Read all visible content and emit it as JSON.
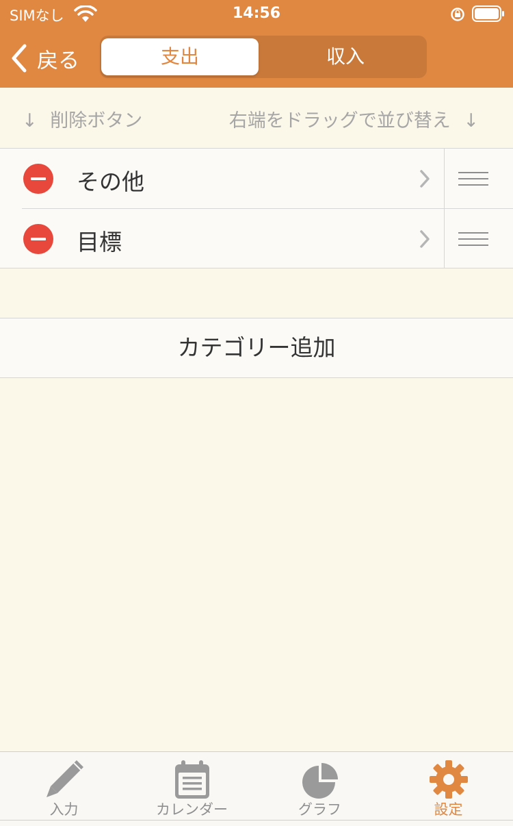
{
  "status_bar": {
    "carrier": "SIMなし",
    "time": "14:56"
  },
  "nav": {
    "back_label": "戻る",
    "segments": [
      {
        "label": "支出",
        "selected": true
      },
      {
        "label": "収入",
        "selected": false
      }
    ]
  },
  "hints": {
    "left_arrow": "↓",
    "left": "削除ボタン",
    "right": "右端をドラッグで並び替え",
    "right_arrow": "↓"
  },
  "categories": [
    {
      "label": "その他"
    },
    {
      "label": "目標"
    }
  ],
  "add_category_label": "カテゴリー追加",
  "tabs": [
    {
      "label": "入力",
      "icon": "pencil-icon",
      "active": false
    },
    {
      "label": "カレンダー",
      "icon": "calendar-icon",
      "active": false
    },
    {
      "label": "グラフ",
      "icon": "pie-chart-icon",
      "active": false
    },
    {
      "label": "設定",
      "icon": "gear-icon",
      "active": true
    }
  ],
  "colors": {
    "accent": "#e08842",
    "delete": "#e8483c",
    "background": "#fbf7e9"
  }
}
